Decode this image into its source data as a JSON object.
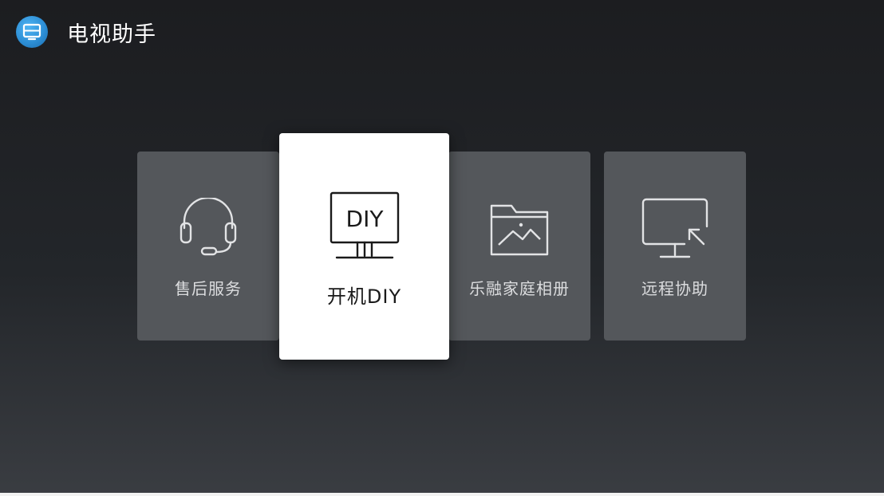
{
  "app": {
    "title": "电视助手",
    "logo_icon": "tv-assistant-logo-icon",
    "accent_color": "#2d8fd6"
  },
  "menu": {
    "selected_index": 1,
    "tiles": [
      {
        "label": "售后服务",
        "icon": "headset-icon"
      },
      {
        "label": "开机DIY",
        "icon": "diy-monitor-icon",
        "icon_text": "DIY"
      },
      {
        "label": "乐融家庭相册",
        "icon": "photo-folder-icon"
      },
      {
        "label": "远程协助",
        "icon": "remote-monitor-icon"
      }
    ]
  }
}
